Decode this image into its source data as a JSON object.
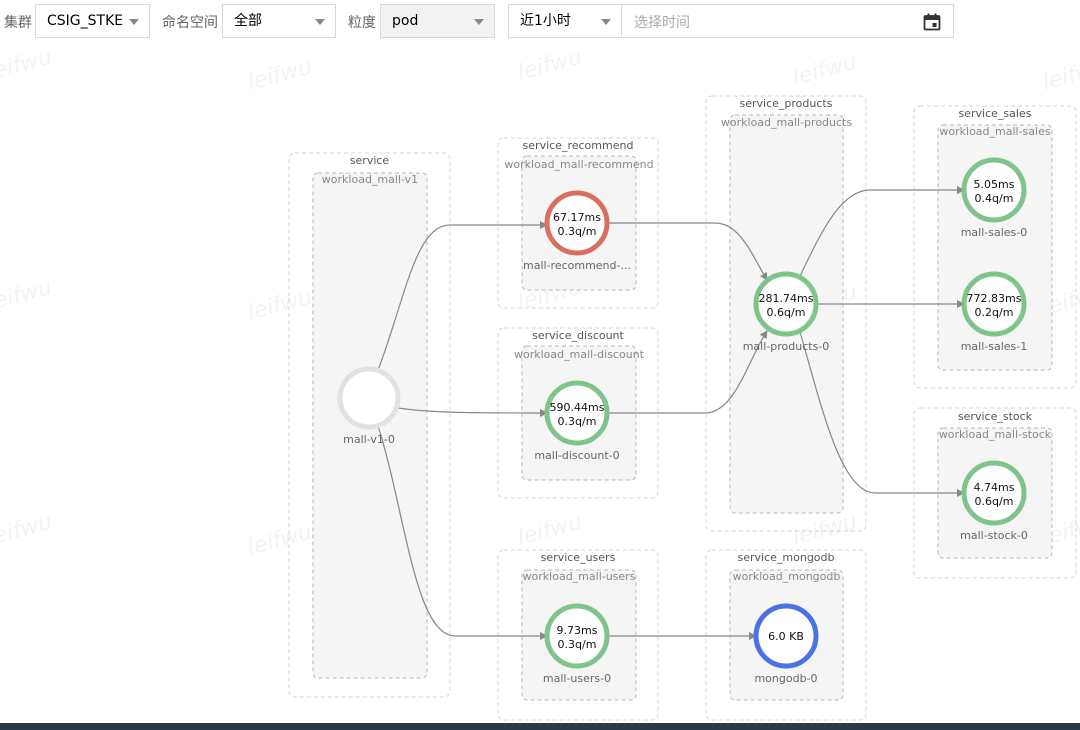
{
  "toolbar": {
    "cluster_label": "集群",
    "cluster_value": "CSIG_STKE",
    "namespace_label": "命名空间",
    "namespace_value": "全部",
    "granularity_label": "粒度",
    "granularity_value": "pod",
    "range_value": "近1小时",
    "time_placeholder": "选择时间"
  },
  "watermark_text": "leifwu",
  "colors": {
    "ok": "#7fc48a",
    "slow": "#d9705f",
    "db": "#4a72e6",
    "source": "#e2e2e2",
    "edge": "#888888"
  },
  "groups": [
    {
      "id": "service",
      "service": "service",
      "workload": "workload_mall-v1"
    },
    {
      "id": "recommend",
      "service": "service_recommend",
      "workload": "workload_mall-recommend"
    },
    {
      "id": "discount",
      "service": "service_discount",
      "workload": "workload_mall-discount"
    },
    {
      "id": "users",
      "service": "service_users",
      "workload": "workload_mall-users"
    },
    {
      "id": "products",
      "service": "service_products",
      "workload": "workload_mall-products"
    },
    {
      "id": "mongodb",
      "service": "service_mongodb",
      "workload": "workload_mongodb"
    },
    {
      "id": "sales",
      "service": "service_sales",
      "workload": "workload_mall-sales"
    },
    {
      "id": "stock",
      "service": "service_stock",
      "workload": "workload_mall-stock"
    }
  ],
  "nodes": [
    {
      "id": "v1",
      "label": "mall-v1-0",
      "line1": "",
      "line2": "",
      "status": "source"
    },
    {
      "id": "recommend",
      "label": "mall-recommend-...",
      "line1": "67.17ms",
      "line2": "0.3q/m",
      "status": "slow"
    },
    {
      "id": "discount",
      "label": "mall-discount-0",
      "line1": "590.44ms",
      "line2": "0.3q/m",
      "status": "ok"
    },
    {
      "id": "users",
      "label": "mall-users-0",
      "line1": "9.73ms",
      "line2": "0.3q/m",
      "status": "ok"
    },
    {
      "id": "products",
      "label": "mall-products-0",
      "line1": "281.74ms",
      "line2": "0.6q/m",
      "status": "ok"
    },
    {
      "id": "mongodb",
      "label": "mongodb-0",
      "line1": "6.0 KB",
      "line2": "",
      "status": "db"
    },
    {
      "id": "sales0",
      "label": "mall-sales-0",
      "line1": "5.05ms",
      "line2": "0.4q/m",
      "status": "ok"
    },
    {
      "id": "sales1",
      "label": "mall-sales-1",
      "line1": "772.83ms",
      "line2": "0.2q/m",
      "status": "ok"
    },
    {
      "id": "stock",
      "label": "mall-stock-0",
      "line1": "4.74ms",
      "line2": "0.6q/m",
      "status": "ok"
    }
  ],
  "edges": [
    {
      "from": "v1",
      "to": "recommend"
    },
    {
      "from": "v1",
      "to": "discount"
    },
    {
      "from": "v1",
      "to": "users"
    },
    {
      "from": "recommend",
      "to": "products"
    },
    {
      "from": "discount",
      "to": "products"
    },
    {
      "from": "users",
      "to": "mongodb"
    },
    {
      "from": "products",
      "to": "sales0"
    },
    {
      "from": "products",
      "to": "sales1"
    },
    {
      "from": "products",
      "to": "stock"
    }
  ]
}
